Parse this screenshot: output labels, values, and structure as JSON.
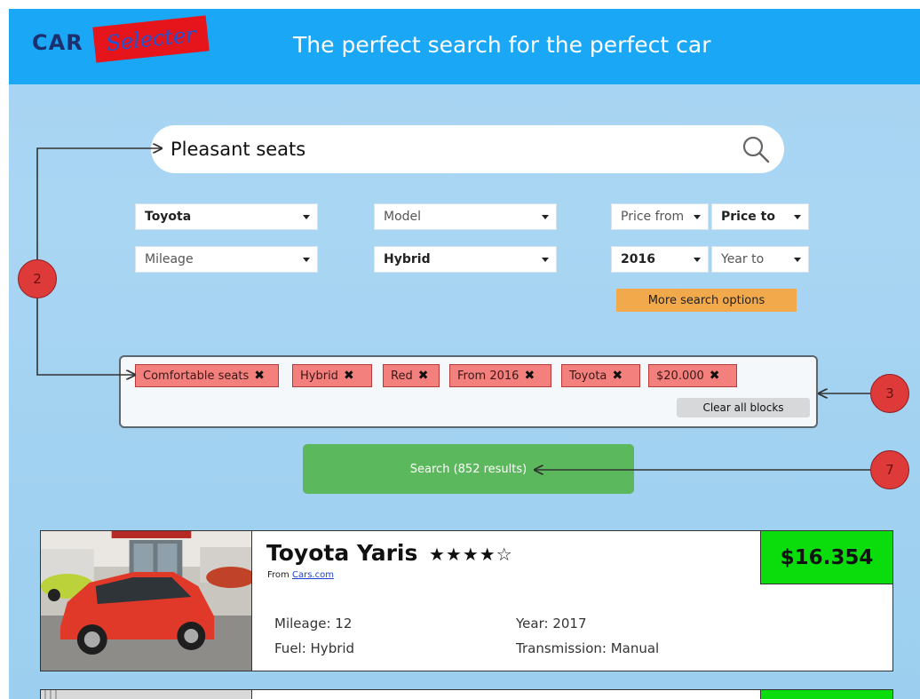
{
  "header": {
    "logo_car": "CAR",
    "logo_selecter": "Selecter",
    "tagline": "The perfect search for the perfect car"
  },
  "search": {
    "value": "Pleasant seats",
    "icon": "search-icon"
  },
  "filters": {
    "make": "Toyota",
    "model": "Model",
    "price_from": "Price from",
    "price_to": "Price to",
    "mileage": "Mileage",
    "fuel": "Hybrid",
    "year_from": "2016",
    "year_to": "Year to",
    "more_options": "More search options"
  },
  "tags": {
    "items": [
      {
        "label": "Comfortable seats"
      },
      {
        "label": "Hybrid"
      },
      {
        "label": "Red"
      },
      {
        "label": "From 2016"
      },
      {
        "label": "Toyota"
      },
      {
        "label": "$20.000"
      }
    ],
    "remove_glyph": "✖",
    "clear_label": "Clear all blocks"
  },
  "search_button": {
    "label": "Search  (852 results)"
  },
  "callouts": {
    "c2": "2",
    "c3": "3",
    "c7": "7"
  },
  "results": [
    {
      "title": "Toyota Yaris",
      "stars": "★★★★☆",
      "rating": 4.5,
      "source_prefix": "From",
      "source_link": "Cars.com",
      "price": "$16.354",
      "mileage": "Mileage: 12",
      "fuel": "Fuel: Hybrid",
      "year": "Year: 2017",
      "transmission": "Transmission: Manual"
    }
  ],
  "colors": {
    "header": "#1aa7f5",
    "chip": "#f4807d",
    "search_button": "#5cb85c",
    "price": "#0bdc0b",
    "more_options": "#f2a94b",
    "callout": "#de3a3a"
  }
}
